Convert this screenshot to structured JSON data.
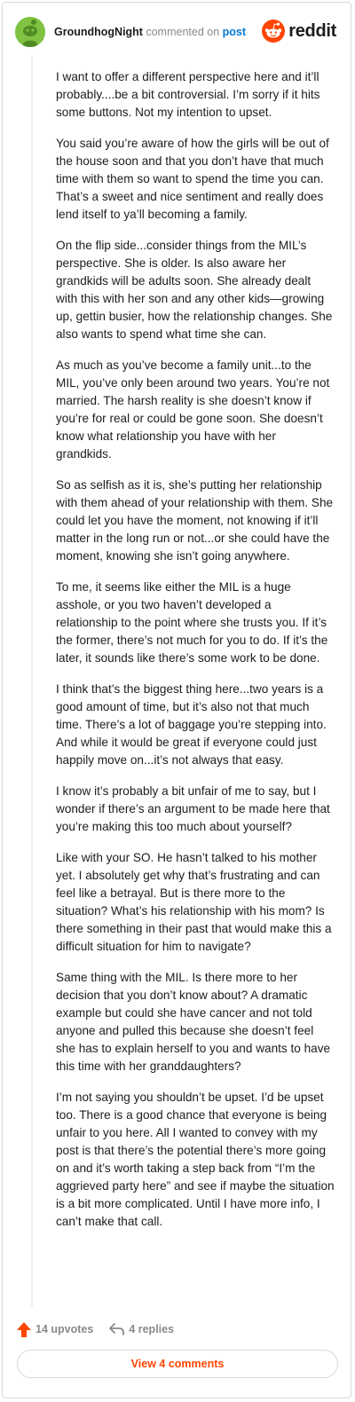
{
  "header": {
    "username": "GroundhogNight",
    "action_text": "commented on",
    "post_link": "post",
    "brand_name": "reddit"
  },
  "comment": {
    "paragraphs": [
      "I want to offer a different perspective here and it’ll probably....be a bit controversial. I’m sorry if it hits some buttons. Not my intention to upset.",
      "You said you’re aware of how the girls will be out of the house soon and that you don’t have that much time with them so want to spend the time you can. That’s a sweet and nice sentiment and really does lend itself to ya’ll becoming a family.",
      "On the flip side...consider things from the MIL’s perspective. She is older. Is also aware her grandkids will be adults soon. She already dealt with this with her son and any other kids—growing up, gettin busier, how the relationship changes. She also wants to spend what time she can.",
      "As much as you’ve become a family unit...to the MIL, you’ve only been around two years. You’re not married. The harsh reality is she doesn’t know if you’re for real or could be gone soon. She doesn’t know what relationship you have with her grandkids.",
      "So as selfish as it is, she’s putting her relationship with them ahead of your relationship with them. She could let you have the moment, not knowing if it’ll matter in the long run or not...or she could have the moment, knowing she isn’t going anywhere.",
      "To me, it seems like either the MIL is a huge asshole, or you two haven’t developed a relationship to the point where she trusts you. If it’s the former, there’s not much for you to do. If it’s the later, it sounds like there’s some work to be done.",
      "I think that’s the biggest thing here...two years is a good amount of time, but it’s also not that much time. There’s a lot of baggage you’re stepping into. And while it would be great if everyone could just happily move on...it’s not always that easy.",
      "I know it’s probably a bit unfair of me to say, but I wonder if there’s an argument to be made here that you’re making this too much about yourself?",
      "Like with your SO. He hasn’t talked to his mother yet. I absolutely get why that’s frustrating and can feel like a betrayal. But is there more to the situation? What’s his relationship with his mom? Is there something in their past that would make this a difficult situation for him to navigate?",
      "Same thing with the MIL. Is there more to her decision that you don’t know about? A dramatic example but could she have cancer and not told anyone and pulled this because she doesn’t feel she has to explain herself to you and wants to have this time with her granddaughters?",
      "I’m not saying you shouldn’t be upset. I’d be upset too. There is a good chance that everyone is being unfair to you here. All I wanted to convey with my post is that there’s the potential there’s more going on and it’s worth taking a step back from “I’m the aggrieved party here” and see if maybe the situation is a bit more complicated. Until I have more info, I can’t make that call."
    ]
  },
  "footer": {
    "upvotes": "14 upvotes",
    "replies": "4 replies",
    "view_comments": "View 4 comments"
  },
  "colors": {
    "accent": "#ff4500",
    "avatar": "#7fc242",
    "muted_text": "#878a8c",
    "link": "#0079d3"
  },
  "icons": {
    "avatar": "snoo-avatar-icon",
    "brand": "reddit-logo-icon",
    "upvote": "upvote-arrow-icon",
    "reply": "reply-arrow-icon"
  }
}
